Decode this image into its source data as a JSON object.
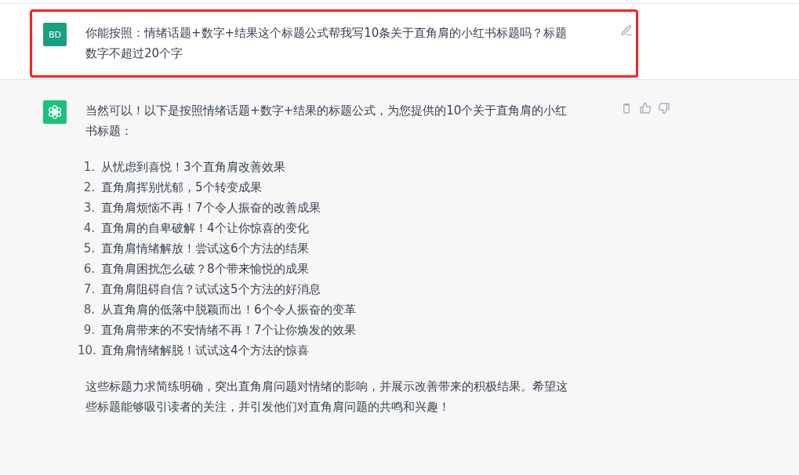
{
  "messages": [
    {
      "kind": "user",
      "avatar": "BD",
      "highlighted": true,
      "paragraphs": [
        "你能按照：情绪话题+数字+结果这个标题公式帮我写10条关于直角肩的小红书标题吗？标题数字不超过20个字"
      ]
    },
    {
      "kind": "assistant",
      "intro": "当然可以！以下是按照情绪话题+数字+结果的标题公式，为您提供的10个关于直角肩的小红书标题：",
      "list": [
        {
          "number": "1.",
          "text": "从忧虑到喜悦！3个直角肩改善效果"
        },
        {
          "number": "2.",
          "text": "直角肩挥别忧郁，5个转变成果"
        },
        {
          "number": "3.",
          "text": "直角肩烦恼不再！7个令人振奋的改善成果"
        },
        {
          "number": "4.",
          "text": "直角肩的自卑破解！4个让你惊喜的变化"
        },
        {
          "number": "5.",
          "text": "直角肩情绪解放！尝试这6个方法的结果"
        },
        {
          "number": "6.",
          "text": "直角肩困扰怎么破？8个带来愉悦的成果"
        },
        {
          "number": "7.",
          "text": "直角肩阻碍自信？试试这5个方法的好消息"
        },
        {
          "number": "8.",
          "text": "从直角肩的低落中脱颖而出！6个令人振奋的变革"
        },
        {
          "number": "9.",
          "text": "直角肩带来的不安情绪不再！7个让你焕发的效果"
        },
        {
          "number": "10.",
          "text": "直角肩情绪解脱！试试这4个方法的惊喜"
        }
      ],
      "outro": "这些标题力求简练明确，突出直角肩问题对情绪的影响，并展示改善带来的积极结果。希望这些标题能够吸引读者的关注，并引发他们对直角肩问题的共鸣和兴趣！"
    }
  ]
}
